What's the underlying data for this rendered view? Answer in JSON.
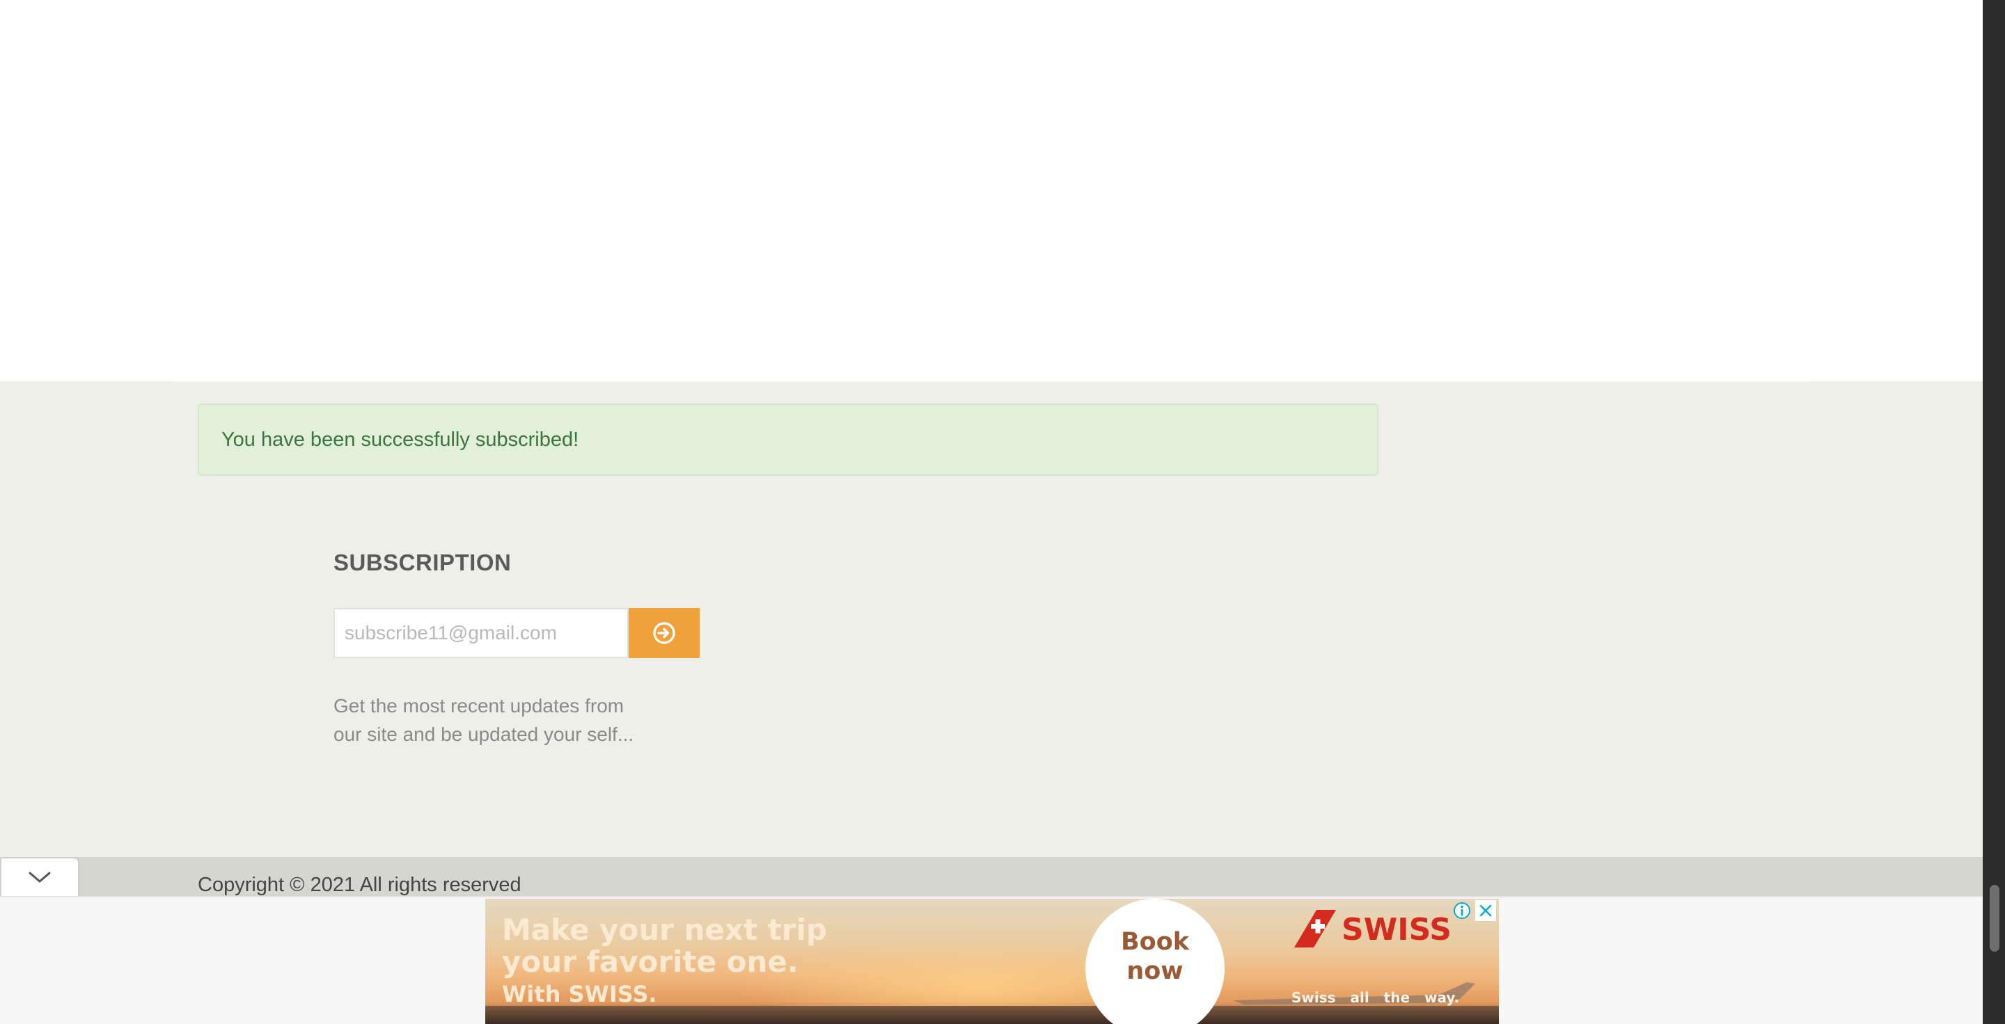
{
  "alert": {
    "message": "You have been successfully subscribed!"
  },
  "subscription": {
    "title": "SUBSCRIPTION",
    "email_placeholder": "subscribe11@gmail.com",
    "submit_icon": "arrow-circle-right-icon",
    "description_line1": "Get the most recent updates from",
    "description_line2": "our site and be updated your self..."
  },
  "footer": {
    "copyright": "Copyright © 2021 All rights reserved",
    "collapse_icon": "chevron-down-icon"
  },
  "ad": {
    "headline_line1": "Make your next trip",
    "headline_line2": "your favorite one.",
    "subline": "With SWISS.",
    "cta_line1": "Book",
    "cta_line2": "now",
    "brand": "SWISS",
    "tagline": "Swiss all the way.",
    "info_icon": "info-icon",
    "close_icon": "close-icon"
  },
  "colors": {
    "accent": "#f0a13a",
    "alert_bg": "#e1efdb",
    "alert_text": "#3c763d",
    "footer_bg": "#efefea",
    "brand_red": "#d52b1e"
  }
}
